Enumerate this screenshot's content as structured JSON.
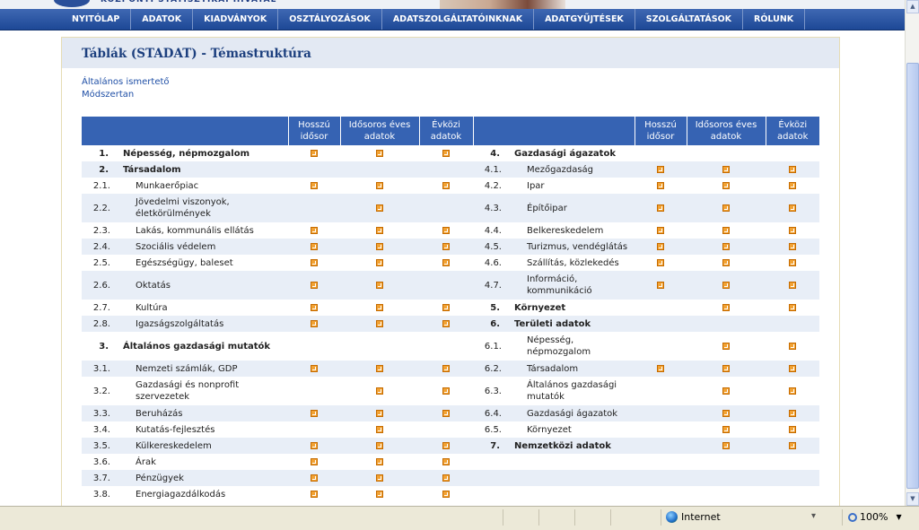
{
  "nav": [
    "NYITÓLAP",
    "ADATOK",
    "KIADVÁNYOK",
    "OSZTÁLYOZÁSOK",
    "ADATSZOLGÁLTATÓINKNAK",
    "ADATGYŰJTÉSEK",
    "SZOLGÁLTATÁSOK",
    "RÓLUNK"
  ],
  "page_title": "Táblák (STADAT) - Témastruktúra",
  "links": [
    "Általános ismertető",
    "Módszertan"
  ],
  "headers": [
    "Hosszú idősor",
    "Idősoros éves adatok",
    "Évközi adatok"
  ],
  "rows": [
    {
      "l": {
        "n": "1.",
        "t": "Népesség, népmozgalom",
        "b": true,
        "i": [
          1,
          1,
          1
        ]
      },
      "r": {
        "n": "4.",
        "t": "Gazdasági ágazatok",
        "b": true,
        "i": [
          0,
          0,
          0
        ]
      }
    },
    {
      "l": {
        "n": "2.",
        "t": "Társadalom",
        "b": true,
        "i": [
          0,
          0,
          0
        ]
      },
      "r": {
        "n": "4.1.",
        "t": "Mezőgazdaság",
        "b": false,
        "i": [
          1,
          1,
          1
        ]
      }
    },
    {
      "l": {
        "n": "2.1.",
        "t": "Munkaerőpiac",
        "b": false,
        "i": [
          1,
          1,
          1
        ]
      },
      "r": {
        "n": "4.2.",
        "t": "Ipar",
        "b": false,
        "i": [
          1,
          1,
          1
        ]
      }
    },
    {
      "l": {
        "n": "2.2.",
        "t": "Jövedelmi viszonyok, életkörülmények",
        "b": false,
        "i": [
          0,
          1,
          0
        ]
      },
      "r": {
        "n": "4.3.",
        "t": "Építőipar",
        "b": false,
        "i": [
          1,
          1,
          1
        ]
      },
      "tall": true
    },
    {
      "l": {
        "n": "2.3.",
        "t": "Lakás, kommunális ellátás",
        "b": false,
        "i": [
          1,
          1,
          1
        ]
      },
      "r": {
        "n": "4.4.",
        "t": "Belkereskedelem",
        "b": false,
        "i": [
          1,
          1,
          1
        ]
      }
    },
    {
      "l": {
        "n": "2.4.",
        "t": "Szociális védelem",
        "b": false,
        "i": [
          1,
          1,
          1
        ]
      },
      "r": {
        "n": "4.5.",
        "t": "Turizmus, vendéglátás",
        "b": false,
        "i": [
          1,
          1,
          1
        ]
      }
    },
    {
      "l": {
        "n": "2.5.",
        "t": "Egészségügy, baleset",
        "b": false,
        "i": [
          1,
          1,
          1
        ]
      },
      "r": {
        "n": "4.6.",
        "t": "Szállítás, közlekedés",
        "b": false,
        "i": [
          1,
          1,
          1
        ]
      }
    },
    {
      "l": {
        "n": "2.6.",
        "t": "Oktatás",
        "b": false,
        "i": [
          1,
          1,
          0
        ]
      },
      "r": {
        "n": "4.7.",
        "t": "Információ, kommunikáció",
        "b": false,
        "i": [
          1,
          1,
          1
        ]
      },
      "tall": true
    },
    {
      "l": {
        "n": "2.7.",
        "t": "Kultúra",
        "b": false,
        "i": [
          1,
          1,
          1
        ]
      },
      "r": {
        "n": "5.",
        "t": "Környezet",
        "b": true,
        "i": [
          0,
          1,
          1
        ]
      }
    },
    {
      "l": {
        "n": "2.8.",
        "t": "Igazságszolgáltatás",
        "b": false,
        "i": [
          1,
          1,
          1
        ]
      },
      "r": {
        "n": "6.",
        "t": "Területi adatok",
        "b": true,
        "i": [
          0,
          0,
          0
        ]
      }
    },
    {
      "l": {
        "n": "3.",
        "t": "Általános gazdasági mutatók",
        "b": true,
        "i": [
          0,
          0,
          0
        ]
      },
      "r": {
        "n": "6.1.",
        "t": "Népesség, népmozgalom",
        "b": false,
        "i": [
          0,
          1,
          1
        ]
      },
      "tall": true
    },
    {
      "l": {
        "n": "3.1.",
        "t": "Nemzeti számlák, GDP",
        "b": false,
        "i": [
          1,
          1,
          1
        ]
      },
      "r": {
        "n": "6.2.",
        "t": "Társadalom",
        "b": false,
        "i": [
          1,
          1,
          1
        ]
      }
    },
    {
      "l": {
        "n": "3.2.",
        "t": "Gazdasági és nonprofit szervezetek",
        "b": false,
        "i": [
          0,
          1,
          1
        ]
      },
      "r": {
        "n": "6.3.",
        "t": "Általános gazdasági mutatók",
        "b": false,
        "i": [
          0,
          1,
          1
        ]
      },
      "tall": true
    },
    {
      "l": {
        "n": "3.3.",
        "t": "Beruházás",
        "b": false,
        "i": [
          1,
          1,
          1
        ]
      },
      "r": {
        "n": "6.4.",
        "t": "Gazdasági ágazatok",
        "b": false,
        "i": [
          0,
          1,
          1
        ]
      }
    },
    {
      "l": {
        "n": "3.4.",
        "t": "Kutatás-fejlesztés",
        "b": false,
        "i": [
          0,
          1,
          0
        ]
      },
      "r": {
        "n": "6.5.",
        "t": "Környezet",
        "b": false,
        "i": [
          0,
          1,
          1
        ]
      }
    },
    {
      "l": {
        "n": "3.5.",
        "t": "Külkereskedelem",
        "b": false,
        "i": [
          1,
          1,
          1
        ]
      },
      "r": {
        "n": "7.",
        "t": "Nemzetközi adatok",
        "b": true,
        "i": [
          0,
          1,
          1
        ]
      }
    },
    {
      "l": {
        "n": "3.6.",
        "t": "Árak",
        "b": false,
        "i": [
          1,
          1,
          1
        ]
      },
      "r": {
        "n": "",
        "t": "",
        "b": false,
        "i": [
          0,
          0,
          0
        ]
      }
    },
    {
      "l": {
        "n": "3.7.",
        "t": "Pénzügyek",
        "b": false,
        "i": [
          1,
          1,
          1
        ]
      },
      "r": {
        "n": "",
        "t": "",
        "b": false,
        "i": [
          0,
          0,
          0
        ]
      }
    },
    {
      "l": {
        "n": "3.8.",
        "t": "Energiagazdálkodás",
        "b": false,
        "i": [
          1,
          1,
          1
        ]
      },
      "r": {
        "n": "",
        "t": "",
        "b": false,
        "i": [
          0,
          0,
          0
        ]
      }
    }
  ],
  "status": {
    "zone": "Internet",
    "zoom": "100%"
  }
}
